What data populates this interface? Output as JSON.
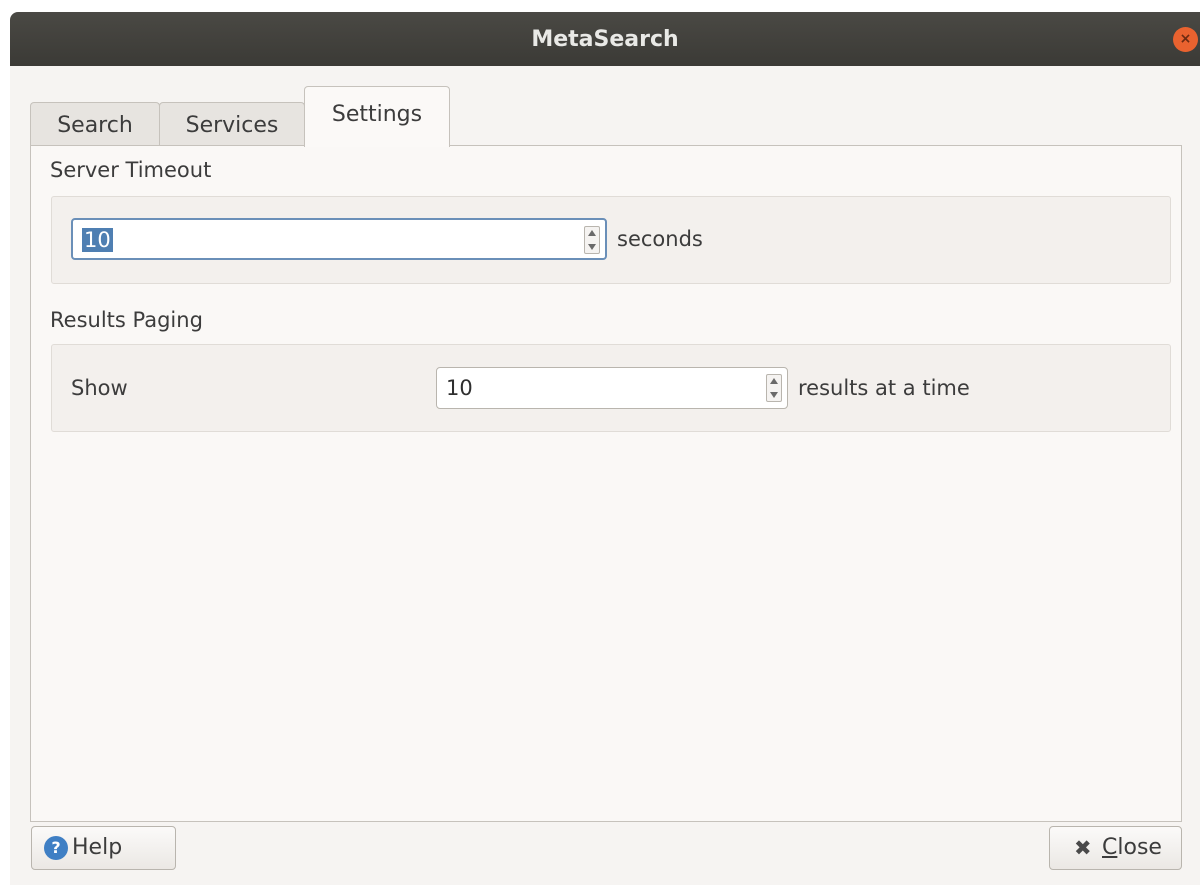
{
  "window": {
    "title": "MetaSearch",
    "close_glyph": "×"
  },
  "tabs": [
    {
      "label": "Search",
      "active": false
    },
    {
      "label": "Services",
      "active": false
    },
    {
      "label": "Settings",
      "active": true
    }
  ],
  "settings": {
    "server_timeout": {
      "title": "Server Timeout",
      "value": "10",
      "suffix": "seconds"
    },
    "results_paging": {
      "title": "Results Paging",
      "label": "Show",
      "value": "10",
      "suffix": "results at a time"
    }
  },
  "footer": {
    "help_label": "Help",
    "help_icon": "?",
    "close_label_prefix": "",
    "close_mnemonic": "C",
    "close_label_rest": "lose",
    "close_icon": "✖"
  },
  "colors": {
    "titlebar": "#3b3a36",
    "window_close": "#e9622f",
    "selection": "#4f7fb2",
    "help_icon": "#3f7fc4"
  }
}
